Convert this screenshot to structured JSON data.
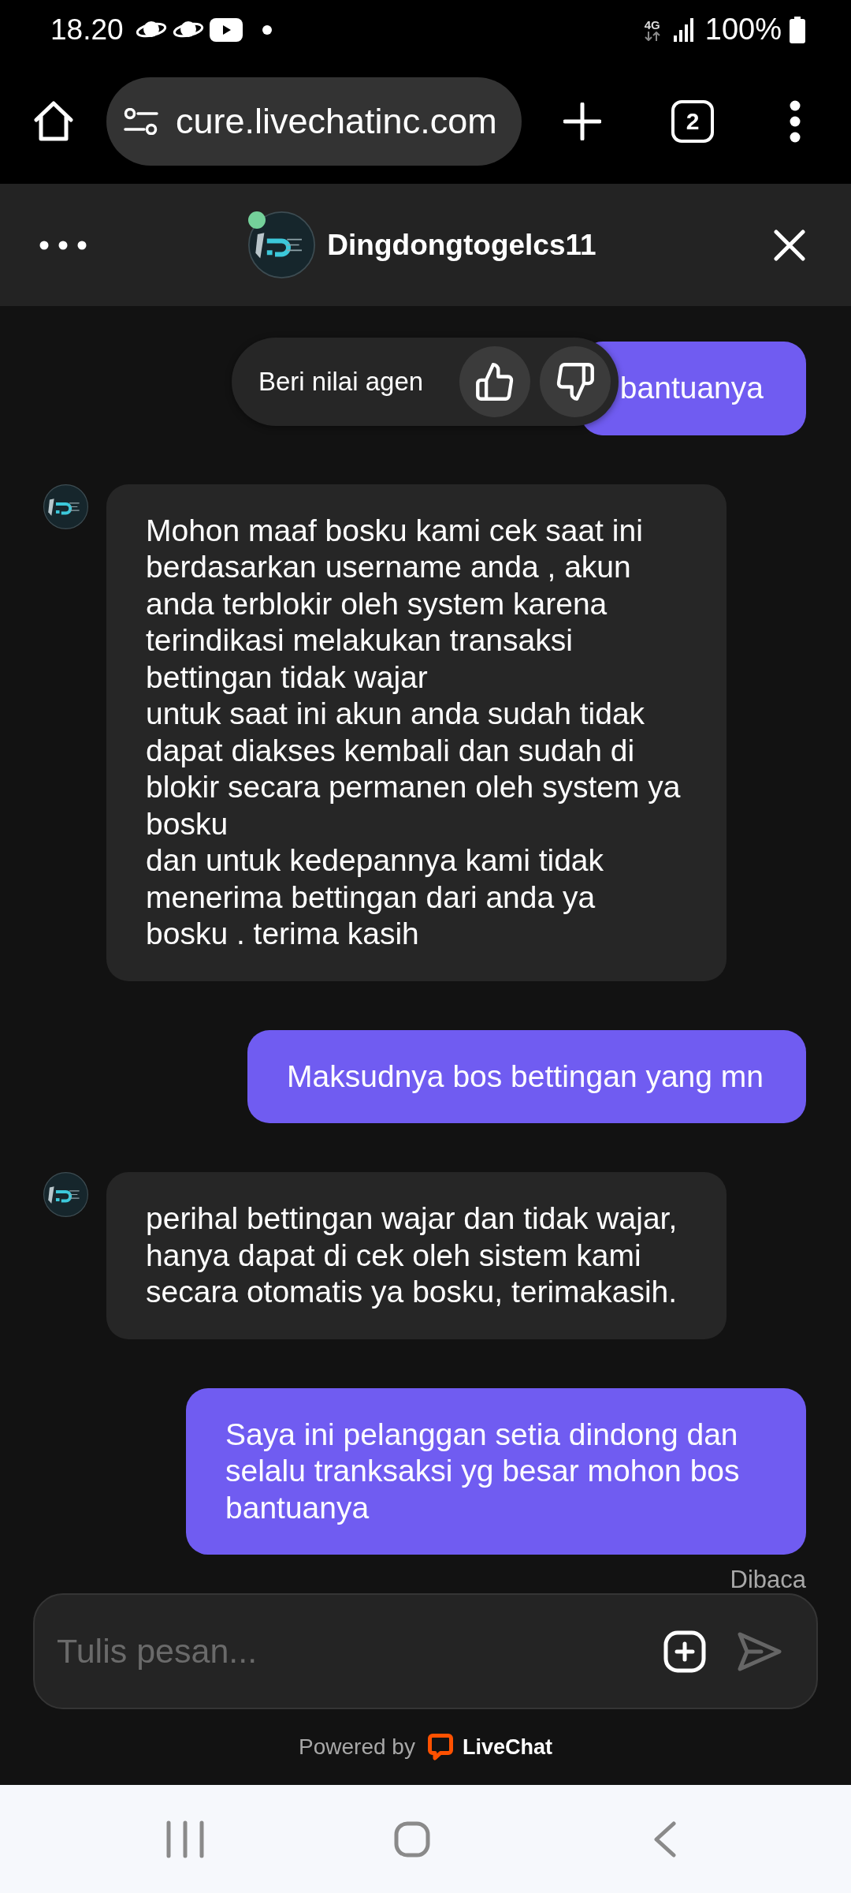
{
  "status_bar": {
    "time": "18.20",
    "network": "4G",
    "battery": "100%"
  },
  "browser": {
    "url": "cure.livechatinc.com",
    "tab_count": "2"
  },
  "chat_header": {
    "agent_name": "Dingdongtogelcs11",
    "online": true
  },
  "rating_prompt": {
    "label": "Beri nilai agen"
  },
  "messages": [
    {
      "kind": "visitor",
      "text": "bantuanya"
    },
    {
      "kind": "agent",
      "text": "Mohon maaf bosku kami cek saat ini berdasarkan username anda , akun anda terblokir oleh system karena terindikasi melakukan transaksi bettingan tidak wajar\nuntuk saat ini akun anda sudah tidak dapat diakses kembali dan sudah di blokir secara permanen oleh system ya bosku\ndan untuk kedepannya kami tidak menerima bettingan dari anda ya bosku . terima kasih"
    },
    {
      "kind": "visitor",
      "text": "Maksudnya bos bettingan yang mn"
    },
    {
      "kind": "agent",
      "text": "perihal bettingan wajar dan tidak wajar, hanya dapat di cek oleh sistem kami secara otomatis ya bosku, terimakasih."
    },
    {
      "kind": "visitor",
      "text": "Saya ini pelanggan setia dindong dan selalu tranksaksi yg besar mohon bos bantuanya"
    }
  ],
  "read_receipt": "Dibaca",
  "composer": {
    "placeholder": "Tulis pesan..."
  },
  "footer": {
    "powered_by": "Powered by",
    "brand": "LiveChat"
  }
}
